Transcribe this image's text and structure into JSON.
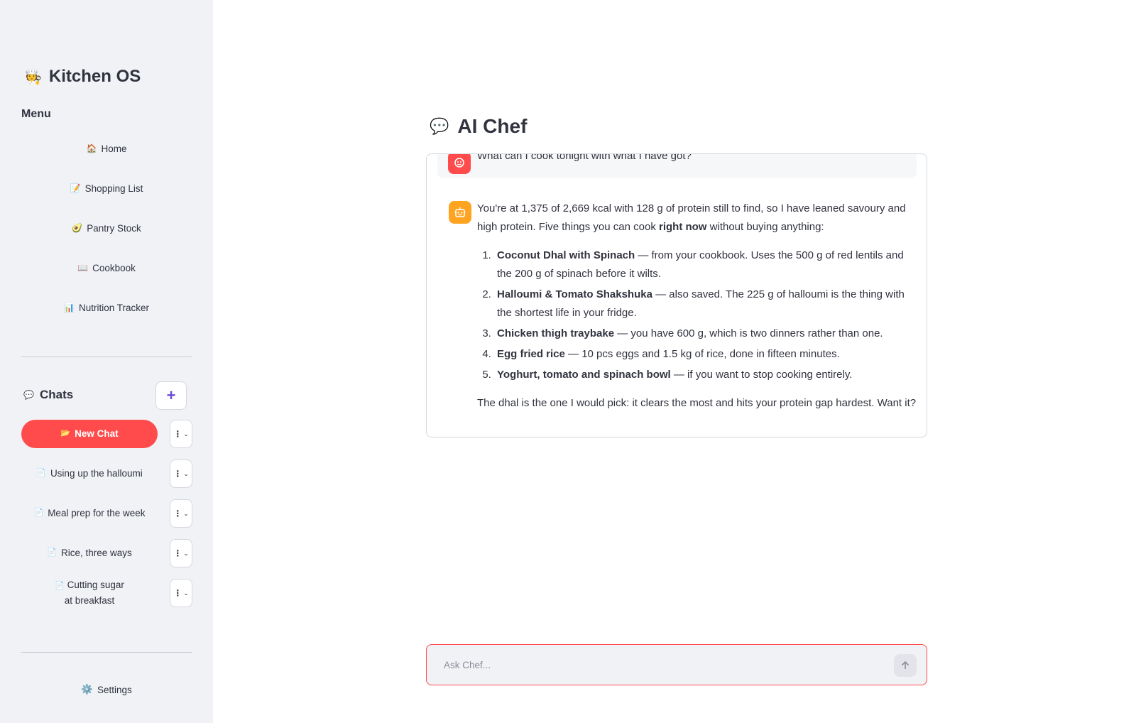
{
  "sidebar": {
    "brand": {
      "icon": "🧑‍🍳",
      "title": "Kitchen OS"
    },
    "menu_title": "Menu",
    "nav": [
      {
        "icon": "🏠",
        "label": "Home"
      },
      {
        "icon": "📝",
        "label": "Shopping List"
      },
      {
        "icon": "🥑",
        "label": "Pantry Stock"
      },
      {
        "icon": "📖",
        "label": "Cookbook"
      },
      {
        "icon": "📊",
        "label": "Nutrition Tracker"
      }
    ],
    "chats": {
      "icon": "💬",
      "title": "Chats",
      "add_label": "+",
      "items": [
        {
          "icon": "📂",
          "label": "New Chat",
          "active": true
        },
        {
          "icon": "📄",
          "label": "Using up the halloumi"
        },
        {
          "icon": "📄",
          "label": "Meal prep for the week"
        },
        {
          "icon": "📄",
          "label": "Rice, three ways"
        },
        {
          "icon": "📄",
          "label": "Cutting sugar at breakfast"
        }
      ],
      "menu_dots": "⋮",
      "menu_chevron": "⌄"
    },
    "settings": {
      "icon": "⚙️",
      "label": "Settings"
    }
  },
  "main": {
    "title_icon": "💬",
    "title": "AI Chef",
    "messages": {
      "user": {
        "text": "What can I cook tonight with what I have got?"
      },
      "assistant": {
        "intro_1": "You're at 1,375 of 2,669 kcal with 128 g of protein still to find, so I have leaned savoury and high protein. Five things you can cook ",
        "intro_bold": "right now",
        "intro_2": " without buying anything:",
        "items": [
          {
            "bold": "Coconut Dhal with Spinach",
            "text": " — from your cookbook. Uses the 500 g of red lentils and the 200 g of spinach before it wilts."
          },
          {
            "bold": "Halloumi & Tomato Shakshuka",
            "text": " — also saved. The 225 g of halloumi is the thing with the shortest life in your fridge."
          },
          {
            "bold": "Chicken thigh traybake",
            "text": " — you have 600 g, which is two dinners rather than one."
          },
          {
            "bold": "Egg fried rice",
            "text": " — 10 pcs eggs and 1.5 kg of rice, done in fifteen minutes."
          },
          {
            "bold": "Yoghurt, tomato and spinach bowl",
            "text": " — if you want to stop cooking entirely."
          }
        ],
        "outro": "The dhal is the one I would pick: it clears the most and hits your protein gap hardest. Want it?"
      }
    },
    "input": {
      "placeholder": "Ask Chef...",
      "value": ""
    },
    "send_icon": "arrow-up-icon"
  },
  "colors": {
    "accent": "#ff4b4b",
    "sidebar_bg": "#f0f2f6",
    "bot_avatar": "#ffa421",
    "add_icon": "#6c4bcf"
  }
}
